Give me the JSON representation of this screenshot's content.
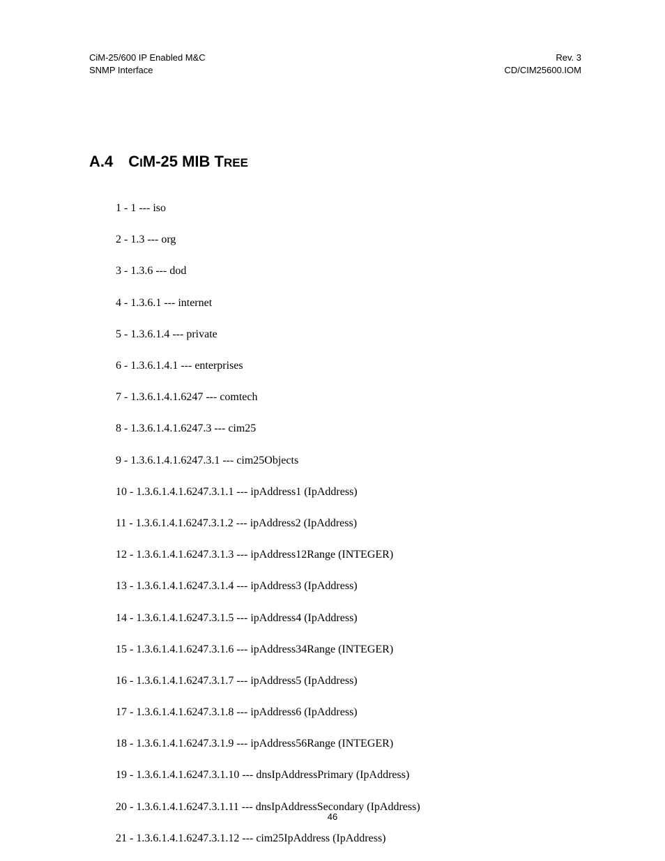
{
  "header": {
    "left_line1": "CiM-25/600 IP Enabled M&C",
    "left_line2": "SNMP Interface",
    "right_line1": "Rev. 3",
    "right_line2": "CD/CIM25600.IOM"
  },
  "heading": {
    "number": "A.4",
    "c1": "C",
    "sc1": "I",
    "c2": "M-25 MIB T",
    "sc2": "REE"
  },
  "tree_items": [
    "1 - 1 --- iso",
    "2 - 1.3 --- org",
    "3 - 1.3.6 --- dod",
    "4 - 1.3.6.1 --- internet",
    "5 - 1.3.6.1.4 --- private",
    "6 - 1.3.6.1.4.1 --- enterprises",
    "7 - 1.3.6.1.4.1.6247 --- comtech",
    "8 - 1.3.6.1.4.1.6247.3 --- cim25",
    "9 - 1.3.6.1.4.1.6247.3.1 --- cim25Objects",
    "10 - 1.3.6.1.4.1.6247.3.1.1 --- ipAddress1 (IpAddress)",
    "11 - 1.3.6.1.4.1.6247.3.1.2 --- ipAddress2 (IpAddress)",
    "12 - 1.3.6.1.4.1.6247.3.1.3 --- ipAddress12Range (INTEGER)",
    "13 - 1.3.6.1.4.1.6247.3.1.4 --- ipAddress3 (IpAddress)",
    "14 - 1.3.6.1.4.1.6247.3.1.5 --- ipAddress4 (IpAddress)",
    "15 - 1.3.6.1.4.1.6247.3.1.6 --- ipAddress34Range (INTEGER)",
    "16 - 1.3.6.1.4.1.6247.3.1.7 --- ipAddress5 (IpAddress)",
    "17 - 1.3.6.1.4.1.6247.3.1.8 --- ipAddress6 (IpAddress)",
    "18 - 1.3.6.1.4.1.6247.3.1.9 --- ipAddress56Range (INTEGER)",
    "19 - 1.3.6.1.4.1.6247.3.1.10 --- dnsIpAddressPrimary (IpAddress)",
    "20 - 1.3.6.1.4.1.6247.3.1.11 --- dnsIpAddressSecondary (IpAddress)",
    "21 - 1.3.6.1.4.1.6247.3.1.12 --- cim25IpAddress (IpAddress)"
  ],
  "page_number": "46"
}
